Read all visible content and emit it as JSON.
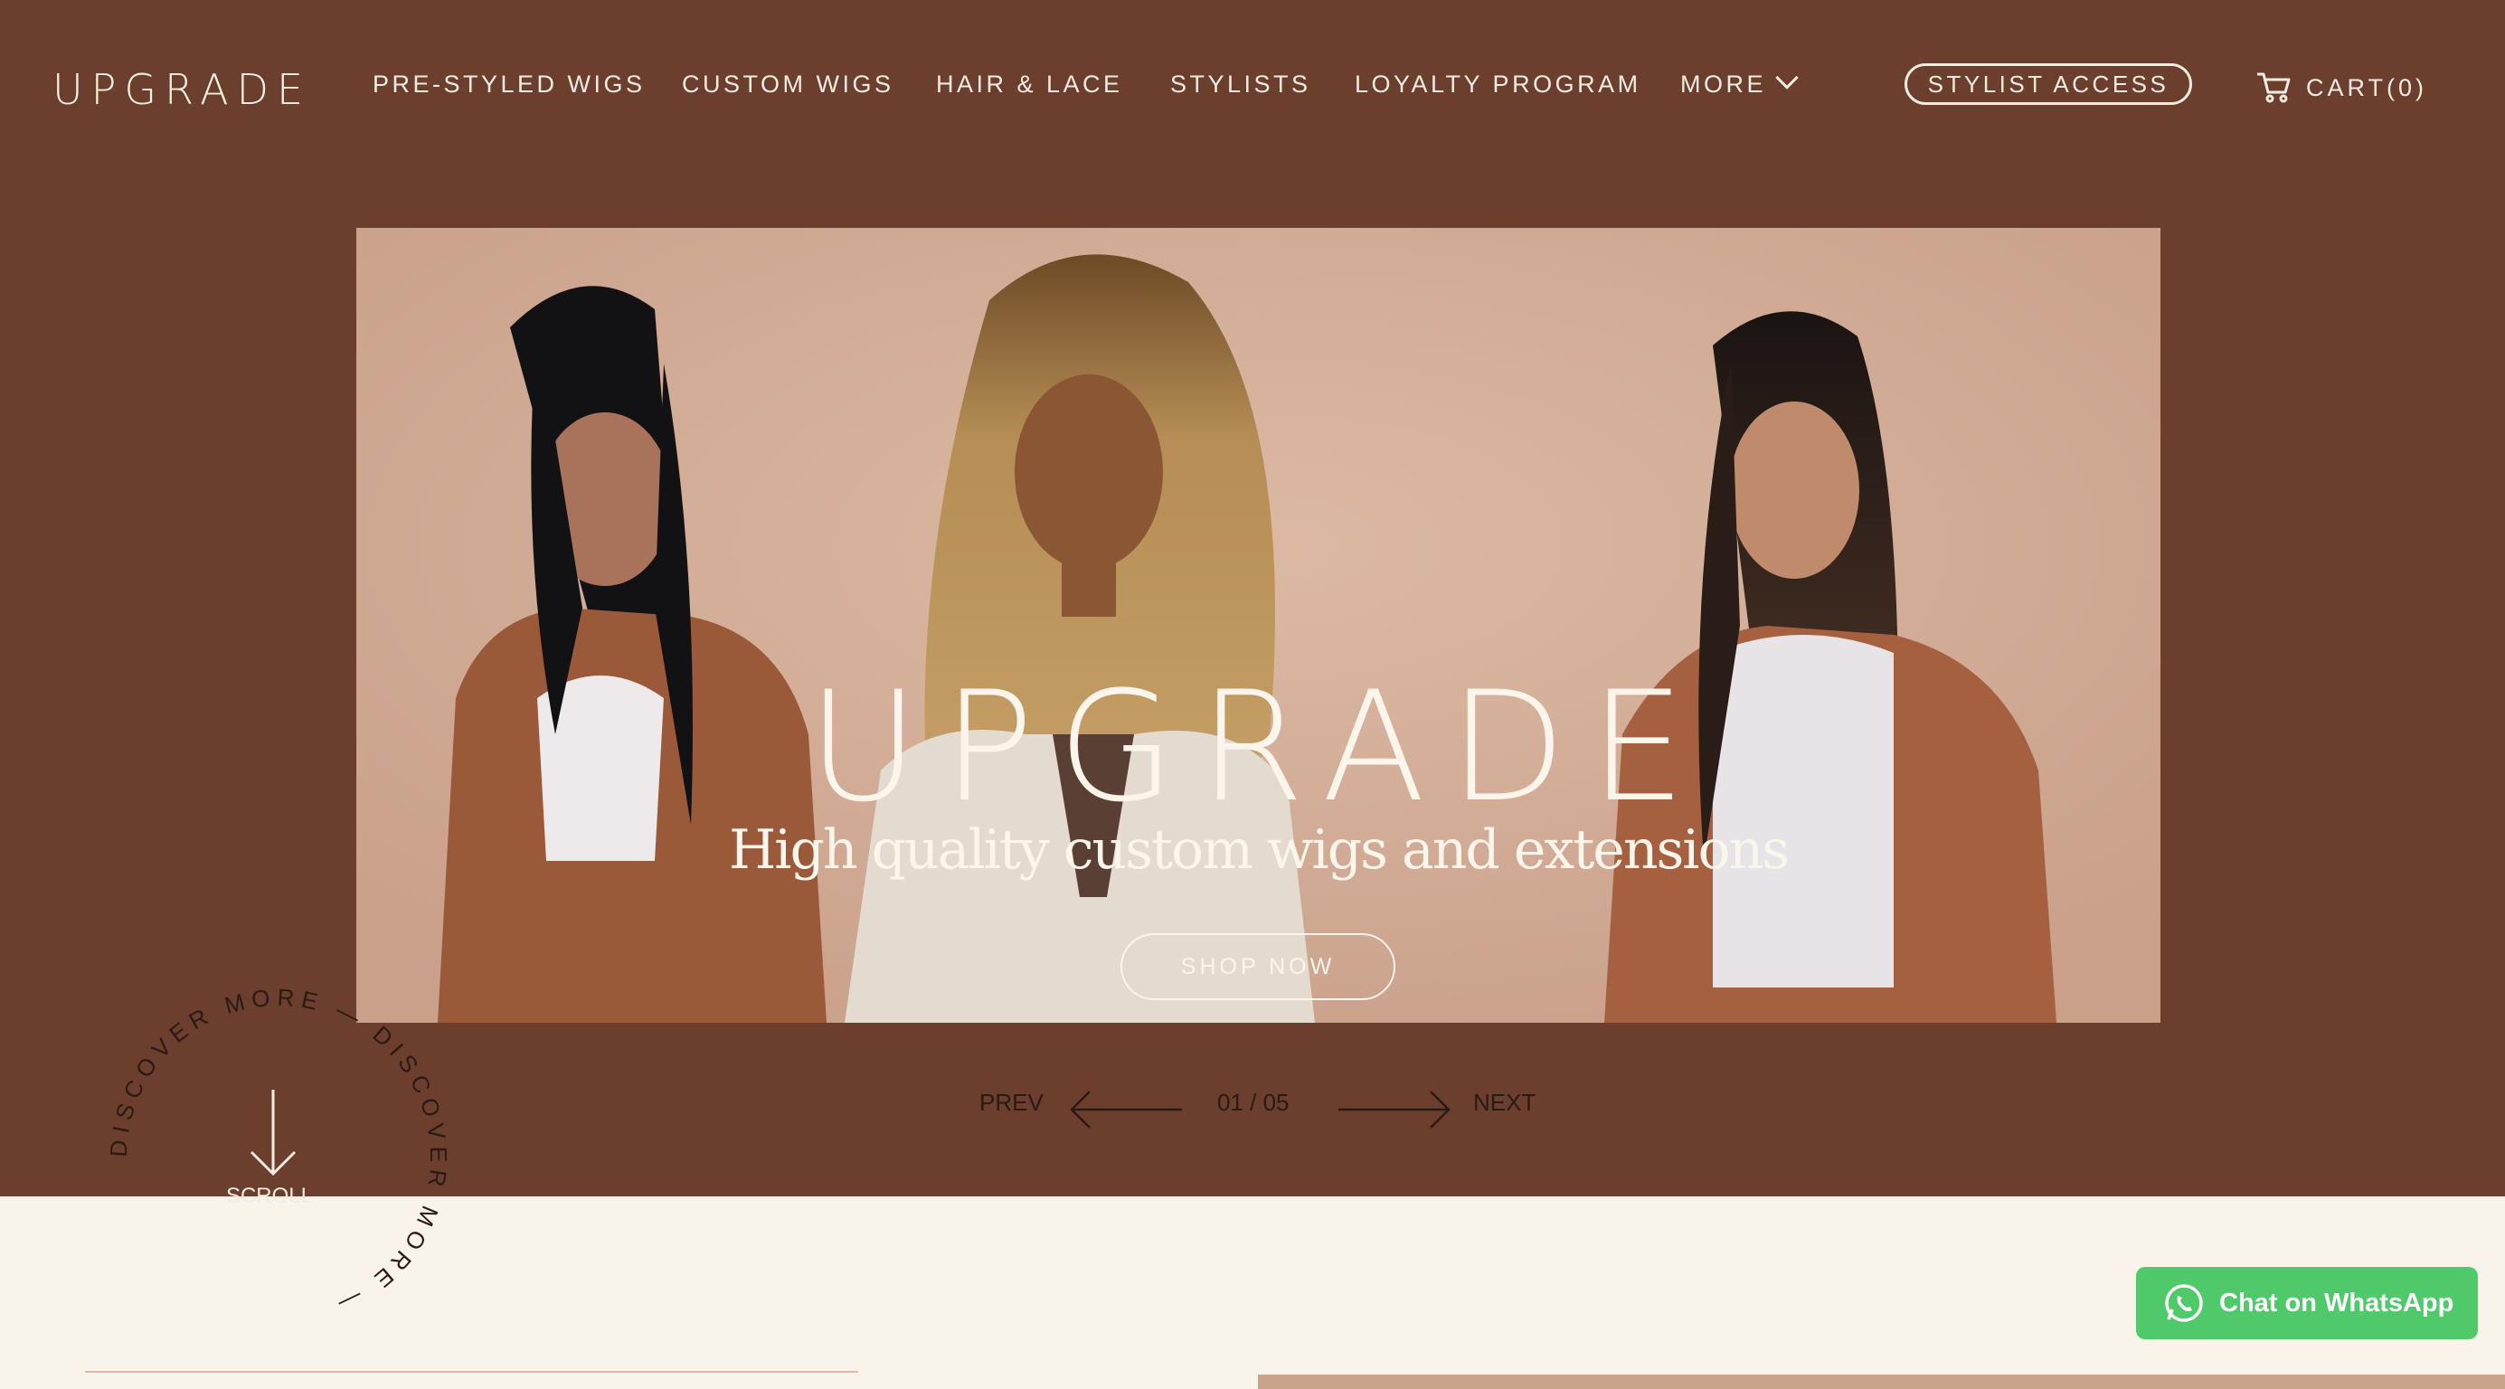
{
  "header": {
    "logo": "UPGRADE",
    "nav": [
      {
        "label": "PRE-STYLED WIGS"
      },
      {
        "label": "CUSTOM WIGS"
      },
      {
        "label": "HAIR & LACE"
      },
      {
        "label": "STYLISTS"
      },
      {
        "label": "LOYALTY PROGRAM"
      },
      {
        "label": "MORE",
        "icon": "chevron-down-icon"
      }
    ],
    "stylist_access": "STYLIST ACCESS",
    "cart": {
      "label": "CART(0)",
      "icon": "cart-icon"
    }
  },
  "hero": {
    "title": "UPGRADE",
    "subtitle": "High quality custom wigs and extensions",
    "cta": "SHOP NOW"
  },
  "slider": {
    "prev": "PREV",
    "next": "NEXT",
    "counter": "01 / 05"
  },
  "discover": {
    "ring_text": "DISCOVER MORE — DISCOVER MORE — ",
    "scroll_label": "SCROLL"
  },
  "whatsapp": {
    "label": "Chat on WhatsApp",
    "icon": "whatsapp-icon"
  },
  "colors": {
    "header_bg": "#6b3e2e",
    "hero_bg": "#d4ae98",
    "lower_bg": "#f9f4ea",
    "whatsapp_green": "#4fc96a",
    "cream_text": "#f5ece1"
  }
}
